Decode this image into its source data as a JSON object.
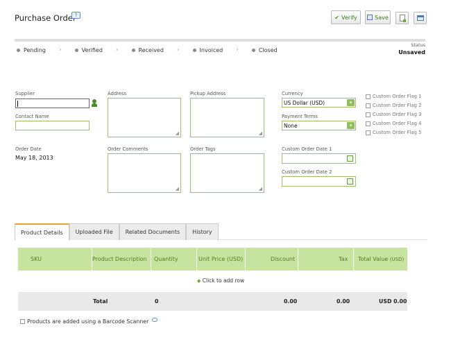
{
  "header": {
    "title": "Purchase Order",
    "verify_label": "Verify",
    "save_label": "Save",
    "status_label": "Status",
    "status_value": "Unsaved"
  },
  "steps": [
    "Pending",
    "Verified",
    "Received",
    "Invoiced",
    "Closed"
  ],
  "form": {
    "supplier_label": "Supplier",
    "contact_label": "Contact Name",
    "order_date_label": "Order Date",
    "order_date_value": "May 18, 2013",
    "address_label": "Address",
    "pickup_label": "Pickup Address",
    "comments_label": "Order Comments",
    "tags_label": "Order Tags",
    "currency_label": "Currency",
    "currency_value": "US Dollar (USD)",
    "payment_label": "Payment Terms",
    "payment_value": "None",
    "custom_date1_label": "Custom Order Date 1",
    "custom_date2_label": "Custom Order Date 2",
    "flags": [
      "Custom Order Flag 1",
      "Custom Order Flag 2",
      "Custom Order Flag 3",
      "Custom Order Flag 4",
      "Custom Order Flag 5"
    ]
  },
  "tabs": [
    "Product Details",
    "Uploaded File",
    "Related Documents",
    "History"
  ],
  "table": {
    "columns": {
      "sku": "SKU",
      "description": "Product Description",
      "quantity": "Quantity",
      "unit_price": "Unit Price (USD)",
      "discount": "Discount",
      "tax": "Tax",
      "total_value": "Total Value",
      "total_value_unit": "(USD)"
    },
    "add_row": "Click to add row",
    "total_label": "Total",
    "total_quantity": "0",
    "total_discount": "0.00",
    "total_tax": "0.00",
    "total_value": "USD 0.00"
  },
  "barcode_label": "Products are added using a Barcode Scanner"
}
